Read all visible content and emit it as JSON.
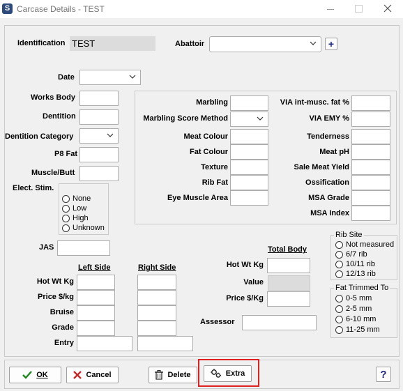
{
  "window": {
    "title": "Carcase Details - TEST"
  },
  "header": {
    "identification_label": "Identification",
    "identification_value": "TEST",
    "abattoir_label": "Abattoir",
    "abattoir_value": "",
    "add_button": "+"
  },
  "left": {
    "date_label": "Date",
    "works_body_label": "Works Body",
    "dentition_label": "Dentition",
    "dentition_category_label": "Dentition Category",
    "p8_fat_label": "P8 Fat",
    "muscle_butt_label": "Muscle/Butt",
    "elect_stim_label": "Elect. Stim.",
    "elect_stim_options": [
      "None",
      "Low",
      "High",
      "Unknown"
    ],
    "jas_label": "JAS"
  },
  "meat": {
    "marbling_label": "Marbling",
    "marbling_score_method_label": "Marbling Score Method",
    "meat_colour_label": "Meat Colour",
    "fat_colour_label": "Fat Colour",
    "texture_label": "Texture",
    "rib_fat_label": "Rib Fat",
    "eye_muscle_area_label": "Eye Muscle Area",
    "via_int_musc_fat_label": "VIA int-musc. fat %",
    "via_emy_label": "VIA EMY %",
    "tenderness_label": "Tenderness",
    "meat_ph_label": "Meat pH",
    "sale_meat_yield_label": "Sale Meat Yield",
    "ossification_label": "Ossification",
    "msa_grade_label": "MSA Grade",
    "msa_index_label": "MSA Index"
  },
  "sides": {
    "left_side_label": "Left Side",
    "right_side_label": "Right Side",
    "total_body_label": "Total Body",
    "hot_wt_kg_label": "Hot Wt Kg",
    "price_kg_label": "Price $/kg",
    "bruise_label": "Bruise",
    "grade_label": "Grade",
    "entry_label": "Entry",
    "total_hot_wt_kg_label": "Hot Wt Kg",
    "value_label": "Value",
    "price_per_kg_label": "Price $/Kg",
    "assessor_label": "Assessor"
  },
  "rib_site": {
    "title": "Rib Site",
    "options": [
      "Not measured",
      "6/7 rib",
      "10/11 rib",
      "12/13 rib"
    ]
  },
  "fat_trimmed": {
    "title": "Fat Trimmed To",
    "options": [
      "0-5 mm",
      "2-5 mm",
      "6-10 mm",
      "11-25 mm"
    ]
  },
  "buttons": {
    "ok": "OK",
    "cancel": "Cancel",
    "delete": "Delete",
    "extra": "Extra",
    "help": "?"
  },
  "colors": {
    "highlight": "#e02020",
    "accent": "#1a237e",
    "ok_check": "#1b8a1b",
    "cancel_x": "#c62828"
  }
}
